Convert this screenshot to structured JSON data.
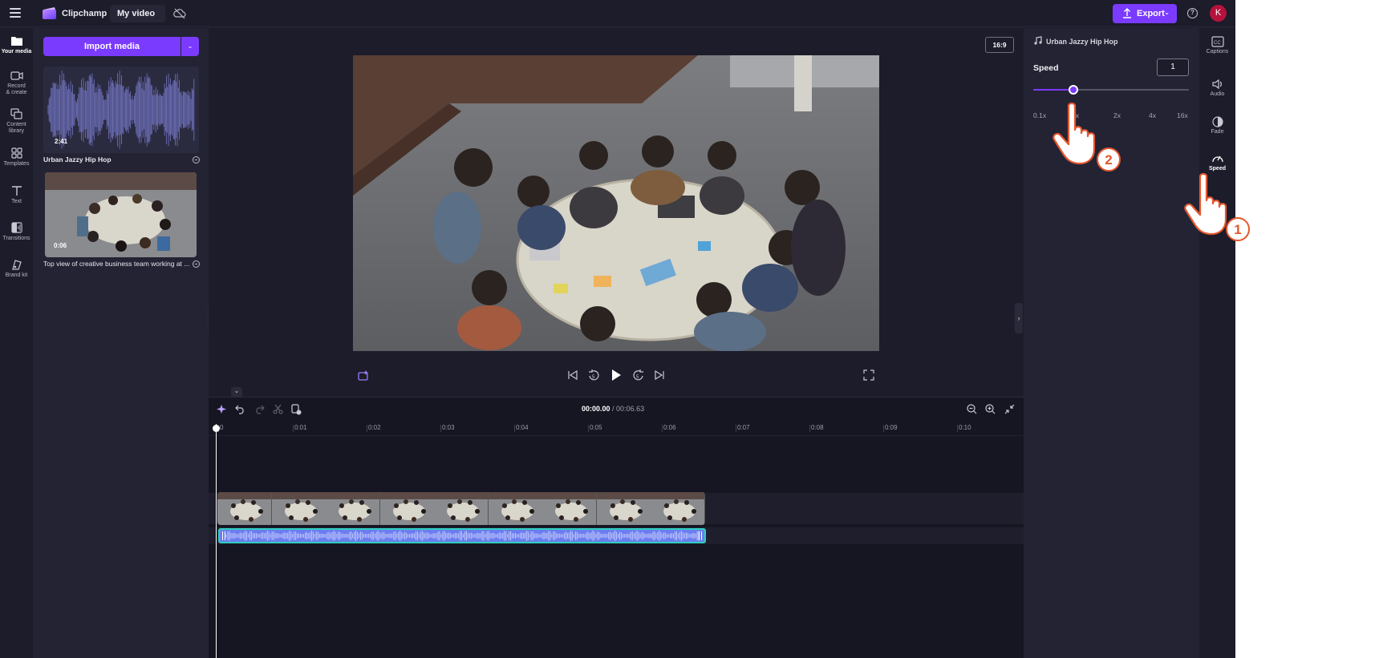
{
  "topbar": {
    "brand": "Clipchamp",
    "project_title": "My video",
    "export_label": "Export",
    "avatar_initial": "K",
    "help_glyph": "?"
  },
  "left_rail": [
    {
      "id": "your-media",
      "label": "Your media",
      "icon": "folder-icon",
      "active": true
    },
    {
      "id": "record-create",
      "label": "Record & create",
      "icon": "camera-icon",
      "active": false
    },
    {
      "id": "content-library",
      "label": "Content library",
      "icon": "library-icon",
      "active": false
    },
    {
      "id": "templates",
      "label": "Templates",
      "icon": "templates-icon",
      "active": false
    },
    {
      "id": "text",
      "label": "Text",
      "icon": "text-icon",
      "active": false
    },
    {
      "id": "transitions",
      "label": "Transitions",
      "icon": "transitions-icon",
      "active": false
    },
    {
      "id": "brand-kit",
      "label": "Brand kit",
      "icon": "brand-kit-icon",
      "active": false
    }
  ],
  "media": {
    "import_label": "Import media",
    "items": [
      {
        "type": "audio",
        "duration": "2:41",
        "name": "Urban Jazzy Hip Hop"
      },
      {
        "type": "video",
        "duration": "0:06",
        "name": "Top view of creative business team working at ..."
      }
    ]
  },
  "preview": {
    "aspect_ratio": "16:9"
  },
  "timeline": {
    "current_time": "00:00.00",
    "total_time": "/ 00:06.63",
    "ruler_ticks": [
      "0",
      "0:01",
      "0:02",
      "0:03",
      "0:04",
      "0:05",
      "0:06",
      "0:07",
      "0:08",
      "0:09",
      "0:10"
    ]
  },
  "properties": {
    "clip_title": "Urban Jazzy Hip Hop",
    "speed_label": "Speed",
    "speed_value": "1",
    "slider_fraction": 0.26,
    "slider_marks": [
      "0.1x",
      "1x",
      "2x",
      "4x",
      "16x"
    ]
  },
  "right_rail": [
    {
      "id": "captions",
      "label": "Captions",
      "icon": "captions-icon",
      "active": false
    },
    {
      "id": "audio",
      "label": "Audio",
      "icon": "speaker-icon",
      "active": false
    },
    {
      "id": "fade",
      "label": "Fade",
      "icon": "fade-icon",
      "active": false
    },
    {
      "id": "speed",
      "label": "Speed",
      "icon": "speedometer-icon",
      "active": true
    }
  ],
  "annotations": {
    "step_one": "1",
    "step_two": "2"
  },
  "colors": {
    "accent": "#7b3bff",
    "app_bg": "#1c1c2b",
    "panel_bg": "#232334",
    "audio_clip": "#6b7df0",
    "clip_outline": "#2fcfbd",
    "annotation": "#e4572e"
  }
}
